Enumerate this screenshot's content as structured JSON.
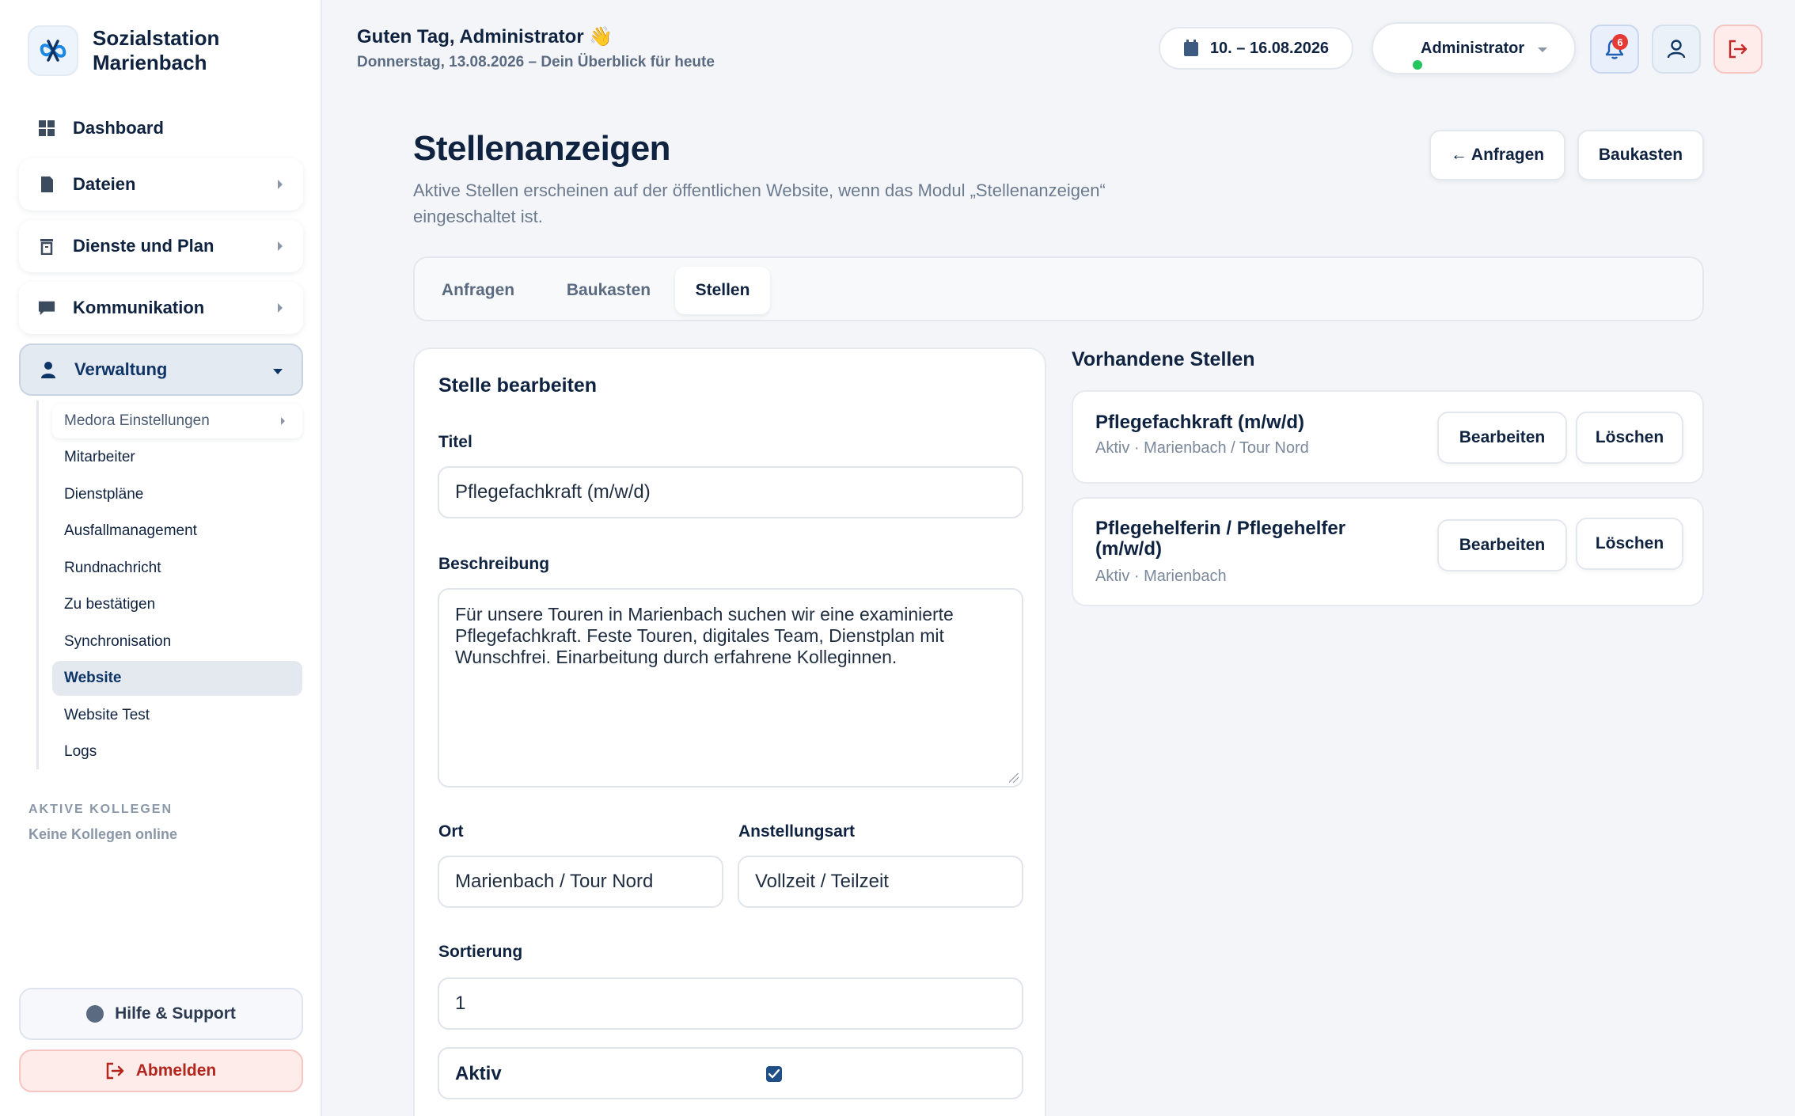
{
  "brand": {
    "name_line1": "Sozialstation",
    "name_line2": "Marienbach"
  },
  "nav": {
    "dashboard": "Dashboard",
    "items": [
      {
        "label": "Dateien",
        "icon": "file-icon"
      },
      {
        "label": "Dienste und Plan",
        "icon": "trash-icon"
      },
      {
        "label": "Kommunikation",
        "icon": "chat-icon"
      },
      {
        "label": "Verwaltung",
        "icon": "person-icon",
        "expanded": true
      }
    ],
    "sub_items": [
      "Medora Einstellungen",
      "Mitarbeiter",
      "Dienstpläne",
      "Ausfallmanagement",
      "Rundnachricht",
      "Zu bestätigen",
      "Synchronisation",
      "Website",
      "Website Test",
      "Logs"
    ],
    "selected": "Website"
  },
  "colleagues": {
    "label": "AKTIVE KOLLEGEN",
    "status": "Keine Kollegen online"
  },
  "footer": {
    "help": "Hilfe & Support",
    "logout": "Abmelden"
  },
  "header": {
    "greeting": "Guten Tag, Administrator",
    "greeting_emoji": "👋",
    "subtitle": "Donnerstag, 13.08.2026 – Dein Überblick für heute",
    "date_range": "10. – 16.08.2026",
    "user": "Administrator",
    "notification_count": "6"
  },
  "page": {
    "title": "Stellenanzeigen",
    "description": "Aktive Stellen erscheinen auf der öffentlichen Website, wenn das Modul „Stellenanzeigen“ eingeschaltet ist.",
    "btn_anfragen": "← Anfragen",
    "btn_baukasten": "Baukasten",
    "tabs": [
      "Anfragen",
      "Baukasten",
      "Stellen"
    ],
    "active_tab": "Stellen"
  },
  "form": {
    "title": "Stelle bearbeiten",
    "titel_label": "Titel",
    "titel_value": "Pflegefachkraft (m/w/d)",
    "beschreibung_label": "Beschreibung",
    "beschreibung_value": "Für unsere Touren in Marienbach suchen wir eine examinierte Pflegefachkraft. Feste Touren, digitales Team, Dienstplan mit Wunschfrei. Einarbeitung durch erfahrene Kolleginnen.",
    "ort_label": "Ort",
    "ort_value": "Marienbach / Tour Nord",
    "art_label": "Anstellungsart",
    "art_value": "Vollzeit / Teilzeit",
    "sort_label": "Sortierung",
    "sort_value": "1",
    "aktiv_label": "Aktiv",
    "aktiv_checked": true
  },
  "jobs": {
    "title": "Vorhandene Stellen",
    "items": [
      {
        "title": "Pflegefachkraft (m/w/d)",
        "meta": "Aktiv · Marienbach / Tour Nord",
        "edit": "Bearbeiten",
        "delete": "Löschen"
      },
      {
        "title": "Pflegehelferin / Pflegehelfer (m/w/d)",
        "meta": "Aktiv · Marienbach",
        "edit": "Bearbeiten",
        "delete": "Löschen"
      }
    ]
  },
  "colors": {
    "primary": "#0f2340",
    "accent": "#1f4f86",
    "danger": "#b3261e",
    "online": "#22c55e"
  }
}
